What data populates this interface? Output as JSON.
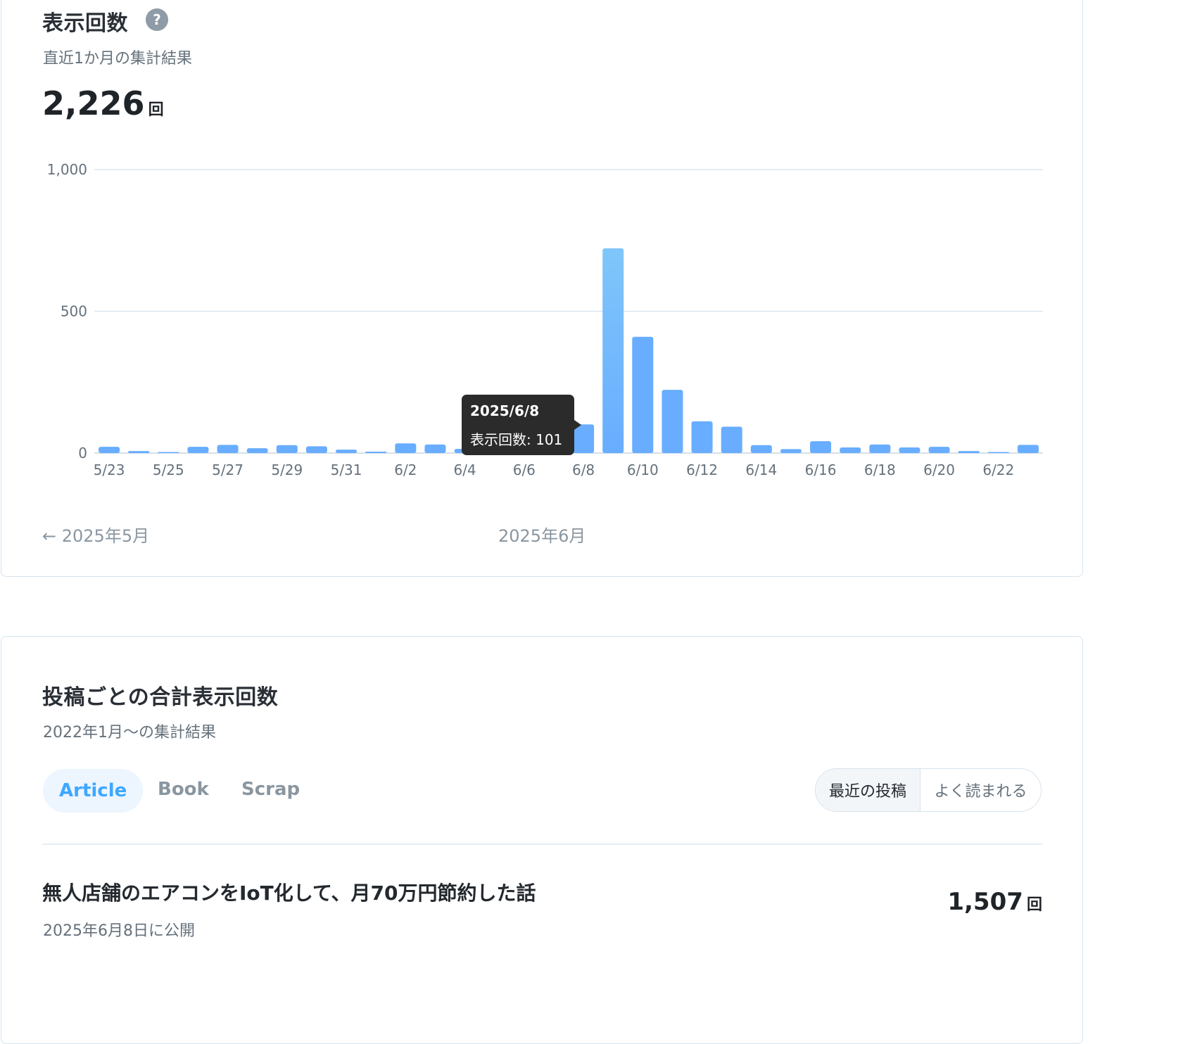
{
  "views_card": {
    "title": "表示回数",
    "help_glyph": "?",
    "help_icon": "question-circle-icon",
    "subtitle": "直近1か月の集計結果",
    "total": "2,226",
    "unit": "回",
    "prev_month_arrow": "←",
    "prev_month_label": "2025年5月",
    "current_month_label": "2025年6月"
  },
  "tooltip": {
    "date": "2025/6/8",
    "text": "表示回数: 101"
  },
  "chart_data": {
    "type": "bar",
    "categories": [
      "5/23",
      "5/24",
      "5/25",
      "5/26",
      "5/27",
      "5/28",
      "5/29",
      "5/30",
      "5/31",
      "6/1",
      "6/2",
      "6/3",
      "6/4",
      "6/5",
      "6/6",
      "6/7",
      "6/8",
      "6/9",
      "6/10",
      "6/11",
      "6/12",
      "6/13",
      "6/14",
      "6/15",
      "6/16",
      "6/17",
      "6/18",
      "6/19",
      "6/20",
      "6/21",
      "6/22",
      "6/23"
    ],
    "tick_labels": [
      "5/23",
      "5/25",
      "5/27",
      "5/29",
      "5/31",
      "6/2",
      "6/4",
      "6/6",
      "6/8",
      "6/10",
      "6/12",
      "6/14",
      "6/16",
      "6/18",
      "6/20",
      "6/22"
    ],
    "values": [
      22,
      7,
      3,
      22,
      29,
      17,
      28,
      24,
      12,
      5,
      34,
      30,
      15,
      22,
      25,
      8,
      101,
      722,
      410,
      223,
      112,
      93,
      28,
      14,
      42,
      20,
      30,
      20,
      22,
      7,
      2,
      29
    ],
    "ylim": [
      0,
      1000
    ],
    "yticks": [
      "0",
      "500",
      "1,000"
    ],
    "ytick_values": [
      0,
      500,
      1000
    ],
    "grid": true,
    "bar_color": "#68adff",
    "peak_color": "#7fc6fa"
  },
  "posts_card": {
    "title": "投稿ごとの合計表示回数",
    "subtitle": "2022年1月〜の集計結果",
    "tabs": [
      {
        "label": "Article",
        "active": true
      },
      {
        "label": "Book",
        "active": false
      },
      {
        "label": "Scrap",
        "active": false
      }
    ],
    "sort_options": [
      "最近の投稿",
      "よく読まれる"
    ],
    "posts": [
      {
        "title": "無人店舗のエアコンをIoT化して、月70万円節約した話",
        "published": "2025年6月8日に公開",
        "count": "1,507",
        "unit": "回"
      }
    ]
  },
  "colors": {
    "accent": "#3ea8ff",
    "tab_active_bg": "#edf5ff",
    "border": "#d6e3ed",
    "tooltip_bg": "#2b2b2b"
  }
}
